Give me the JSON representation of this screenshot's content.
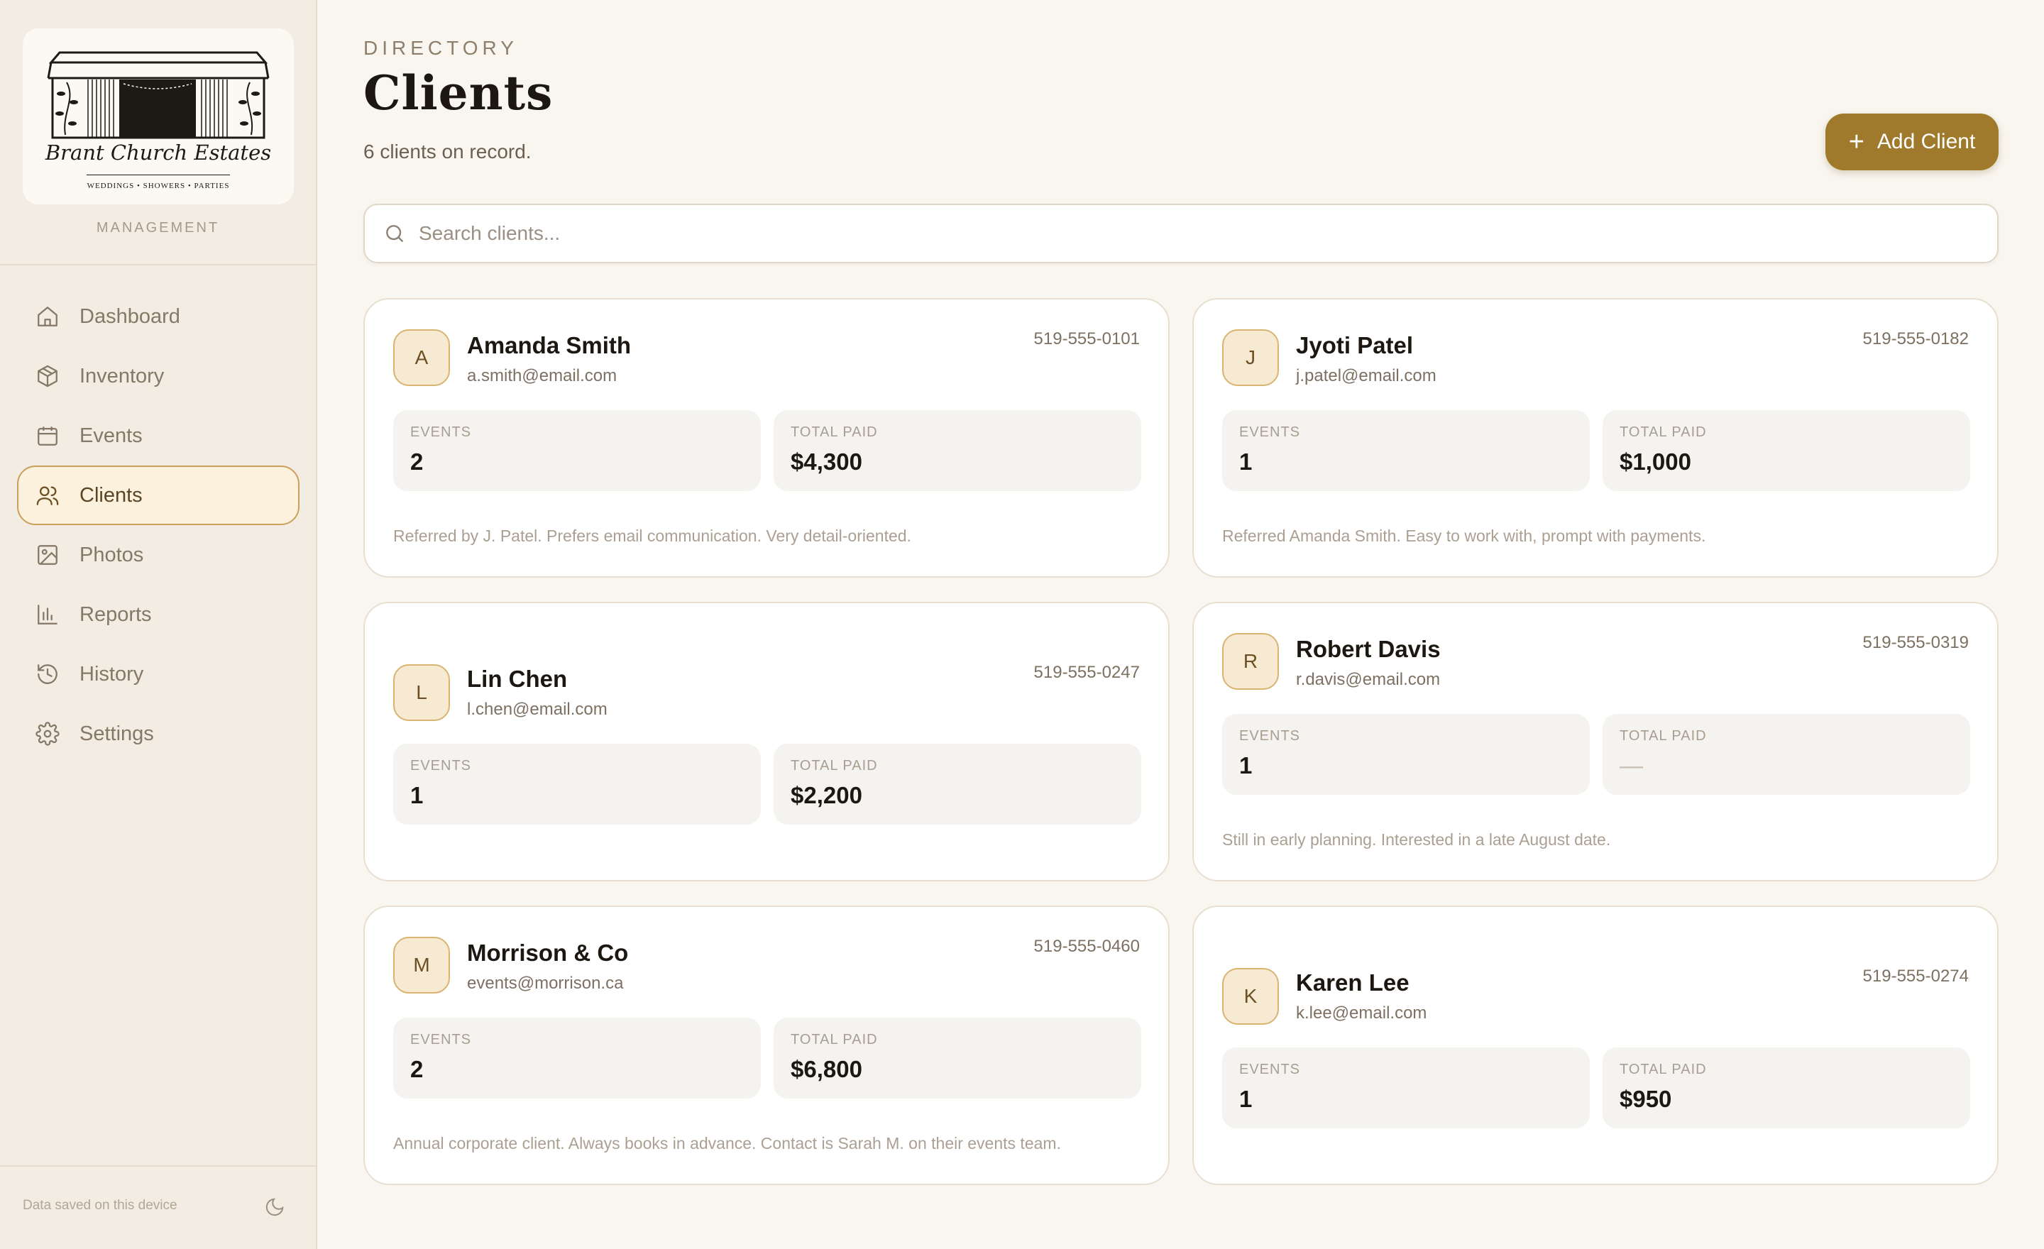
{
  "brand": {
    "name": "Brant Church Estates",
    "tagline": "WEDDINGS • SHOWERS • PARTIES",
    "section": "MANAGEMENT"
  },
  "nav": {
    "items": [
      {
        "label": "Dashboard",
        "icon": "home-icon"
      },
      {
        "label": "Inventory",
        "icon": "box-icon"
      },
      {
        "label": "Events",
        "icon": "calendar-icon"
      },
      {
        "label": "Clients",
        "icon": "users-icon",
        "active": true
      },
      {
        "label": "Photos",
        "icon": "image-icon"
      },
      {
        "label": "Reports",
        "icon": "bar-chart-icon"
      },
      {
        "label": "History",
        "icon": "history-icon"
      },
      {
        "label": "Settings",
        "icon": "gear-icon"
      }
    ]
  },
  "footer": {
    "status": "Data saved on this device",
    "theme_icon": "moon-icon"
  },
  "header": {
    "eyebrow": "DIRECTORY",
    "title": "Clients",
    "subtitle": "6 clients on record.",
    "add_button": "Add Client"
  },
  "search": {
    "placeholder": "Search clients..."
  },
  "stat_labels": {
    "events": "EVENTS",
    "total_paid": "TOTAL PAID"
  },
  "clients": [
    {
      "initial": "A",
      "name": "Amanda Smith",
      "email": "a.smith@email.com",
      "phone": "519-555-0101",
      "events": "2",
      "total_paid": "$4,300",
      "note": "Referred by J. Patel. Prefers email communication. Very detail-oriented."
    },
    {
      "initial": "J",
      "name": "Jyoti Patel",
      "email": "j.patel@email.com",
      "phone": "519-555-0182",
      "events": "1",
      "total_paid": "$1,000",
      "note": "Referred Amanda Smith. Easy to work with, prompt with payments."
    },
    {
      "initial": "L",
      "name": "Lin Chen",
      "email": "l.chen@email.com",
      "phone": "519-555-0247",
      "events": "1",
      "total_paid": "$2,200",
      "note": ""
    },
    {
      "initial": "R",
      "name": "Robert Davis",
      "email": "r.davis@email.com",
      "phone": "519-555-0319",
      "events": "1",
      "total_paid": "—",
      "note": "Still in early planning. Interested in a late August date."
    },
    {
      "initial": "M",
      "name": "Morrison & Co",
      "email": "events@morrison.ca",
      "phone": "519-555-0460",
      "events": "2",
      "total_paid": "$6,800",
      "note": "Annual corporate client. Always books in advance. Contact is Sarah M. on their events team."
    },
    {
      "initial": "K",
      "name": "Karen Lee",
      "email": "k.lee@email.com",
      "phone": "519-555-0274",
      "events": "1",
      "total_paid": "$950",
      "note": ""
    }
  ],
  "colors": {
    "accent": "#a07a2c",
    "sidebar_bg": "#f3ece2",
    "page_bg": "#f9f6f0",
    "active_bg": "#fbf1dc"
  }
}
